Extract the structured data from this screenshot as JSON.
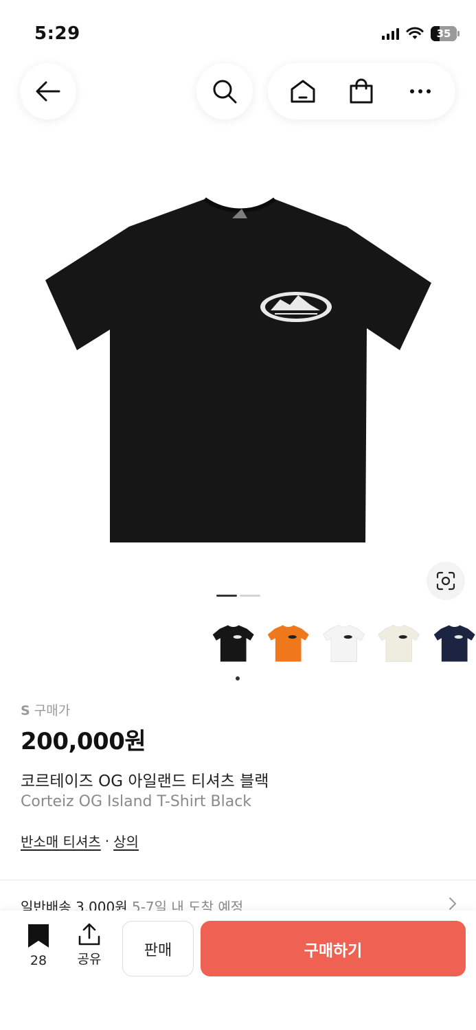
{
  "status_bar": {
    "time": "5:29",
    "battery": "35",
    "battery_level": 0.35
  },
  "nav": {
    "icons": [
      "back-arrow-icon",
      "search-icon",
      "home-icon",
      "shopping-bag-icon",
      "more-icon"
    ]
  },
  "gallery": {
    "page_count": 2,
    "active_page": 1,
    "thumbnails": [
      "black",
      "orange",
      "white",
      "cream",
      "navy"
    ],
    "selected_thumbnail": 0
  },
  "colors": {
    "tee_black": "#161616",
    "tee_orange": "#f0781c",
    "tee_white": "#f4f4f4",
    "tee_cream": "#efece0",
    "tee_navy": "#1c2442",
    "accent": "#ef6253"
  },
  "product": {
    "size": "S",
    "price_type": "구매가",
    "price": "200,000원",
    "title_ko": "코르테이즈 OG 아일랜드 티셔츠 블랙",
    "title_en": "Corteiz OG Island T-Shirt Black",
    "category_1": "반소매 티셔츠",
    "separator": "·",
    "category_2": "상의"
  },
  "shipping": {
    "type": "일반배송 3,000원",
    "eta": "5-7일 내 도착 예정"
  },
  "bottom_bar": {
    "bookmark_count": "28",
    "share_label": "공유",
    "sell_label": "판매",
    "buy_label": "구매하기"
  }
}
